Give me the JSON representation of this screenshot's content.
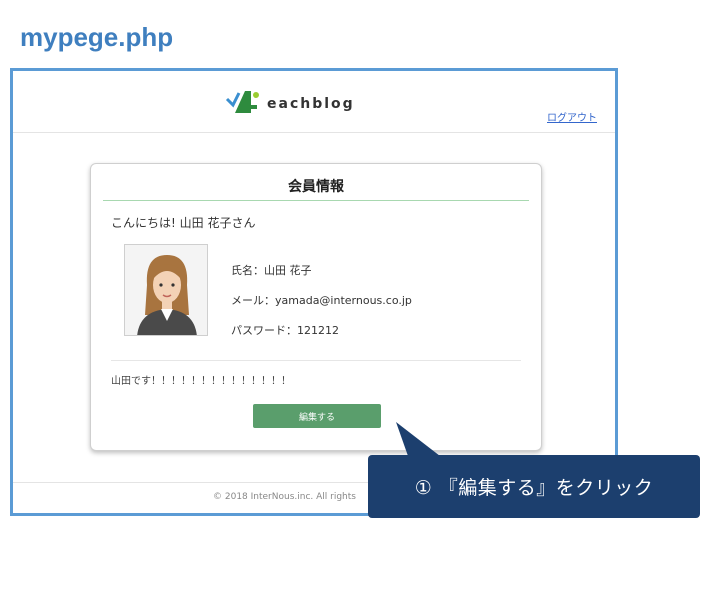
{
  "doc_title": "mypege.php",
  "header": {
    "logo_text": "eachblog",
    "logout_label": "ログアウト"
  },
  "card": {
    "title": "会員情報",
    "greeting": "こんにちは!  山田  花子さん",
    "name_line": "氏名：山田  花子",
    "mail_line": "メール：yamada@internous.co.jp",
    "password_line": "パスワード：121212",
    "bio": "山田です！！！！！！！！！！！！！！",
    "edit_button_label": "編集する",
    "avatar_icon": "woman-avatar-icon"
  },
  "footer": {
    "copyright": "© 2018 InterNous.inc. All rights"
  },
  "callout": {
    "text": "① 『編集する』をクリック",
    "color": "#1c3f6e"
  },
  "colors": {
    "title": "#3f7fbf",
    "frame_border": "#5b9bd5",
    "button": "#5a9e6c",
    "link": "#3366cc"
  }
}
